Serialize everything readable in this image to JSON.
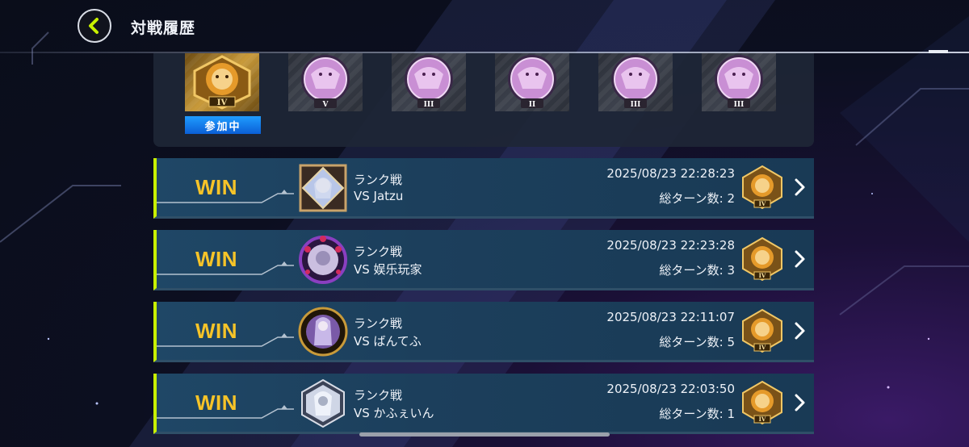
{
  "header": {
    "title": "対戦履歴"
  },
  "ranks": {
    "status_label": "参加中",
    "badges": [
      {
        "numeral": "IV",
        "type": "gold-lion-icon"
      },
      {
        "numeral": "V",
        "type": "purple-beast-icon"
      },
      {
        "numeral": "III",
        "type": "purple-beast-icon"
      },
      {
        "numeral": "II",
        "type": "purple-beast-icon"
      },
      {
        "numeral": "III",
        "type": "purple-beast-icon"
      },
      {
        "numeral": "III",
        "type": "purple-beast-icon"
      }
    ]
  },
  "duels": [
    {
      "result": "WIN",
      "mode": "ランク戦",
      "opponent": "VS Jatzu",
      "datetime": "2025/08/23 22:28:23",
      "turns": "総ターン数: 2",
      "rank": "IV"
    },
    {
      "result": "WIN",
      "mode": "ランク戦",
      "opponent": "VS 娱乐玩家",
      "datetime": "2025/08/23 22:23:28",
      "turns": "総ターン数: 3",
      "rank": "IV"
    },
    {
      "result": "WIN",
      "mode": "ランク戦",
      "opponent": "VS ばんてふ",
      "datetime": "2025/08/23 22:11:07",
      "turns": "総ターン数: 5",
      "rank": "IV"
    },
    {
      "result": "WIN",
      "mode": "ランク戦",
      "opponent": "VS かふぇいん",
      "datetime": "2025/08/23 22:03:50",
      "turns": "総ターン数: 1",
      "rank": "IV"
    }
  ],
  "colors": {
    "win": "#f7c428",
    "accent": "#c8f000",
    "row_bg": "#1f4766",
    "participating": "#1f9cff"
  }
}
